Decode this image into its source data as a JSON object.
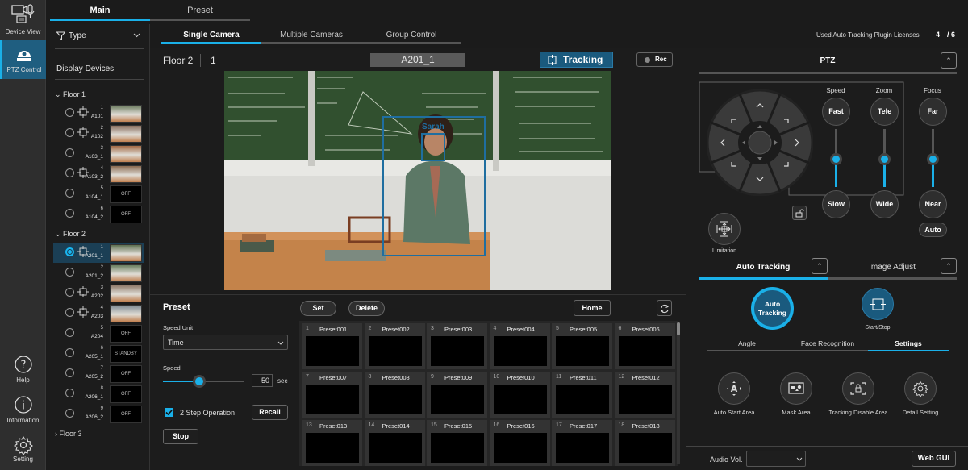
{
  "nav": {
    "items": [
      {
        "label": "Device View",
        "icon": "device-view-icon"
      },
      {
        "label": "PTZ Control",
        "icon": "ptz-camera-icon",
        "active": true
      },
      {
        "label": "Help",
        "icon": "help-icon"
      },
      {
        "label": "Information",
        "icon": "information-icon"
      },
      {
        "label": "Setting",
        "icon": "gear-icon"
      }
    ]
  },
  "top_tabs": [
    {
      "label": "Main",
      "selected": true
    },
    {
      "label": "Preset"
    }
  ],
  "device_panel": {
    "filter_label": "Type",
    "title": "Display Devices",
    "floors": [
      {
        "name": "Floor 1",
        "expanded": true,
        "devices": [
          {
            "num": "1",
            "name": "A101",
            "tracking": true,
            "state": "image"
          },
          {
            "num": "2",
            "name": "A102",
            "tracking": true,
            "state": "image"
          },
          {
            "num": "3",
            "name": "A103_1",
            "tracking": false,
            "state": "image"
          },
          {
            "num": "4",
            "name": "A103_2",
            "tracking": true,
            "state": "image"
          },
          {
            "num": "5",
            "name": "A104_1",
            "tracking": false,
            "state": "OFF"
          },
          {
            "num": "6",
            "name": "A104_2",
            "tracking": false,
            "state": "OFF"
          }
        ]
      },
      {
        "name": "Floor 2",
        "expanded": true,
        "devices": [
          {
            "num": "1",
            "name": "A201_1",
            "tracking": true,
            "state": "image",
            "selected": true
          },
          {
            "num": "2",
            "name": "A201_2",
            "tracking": false,
            "state": "image"
          },
          {
            "num": "3",
            "name": "A202",
            "tracking": true,
            "state": "image"
          },
          {
            "num": "4",
            "name": "A203",
            "tracking": true,
            "state": "image"
          },
          {
            "num": "5",
            "name": "A204",
            "tracking": false,
            "state": "OFF"
          },
          {
            "num": "6",
            "name": "A205_1",
            "tracking": false,
            "state": "STANDBY"
          },
          {
            "num": "7",
            "name": "A205_2",
            "tracking": false,
            "state": "OFF"
          },
          {
            "num": "8",
            "name": "A206_1",
            "tracking": false,
            "state": "OFF"
          },
          {
            "num": "9",
            "name": "A206_2",
            "tracking": false,
            "state": "OFF"
          }
        ]
      },
      {
        "name": "Floor 3",
        "expanded": false,
        "devices": []
      }
    ]
  },
  "sub_tabs": [
    {
      "label": "Single Camera",
      "selected": true
    },
    {
      "label": "Multiple Cameras"
    },
    {
      "label": "Group Control"
    }
  ],
  "license": {
    "label": "Used Auto Tracking Plugin Licenses",
    "used": "4",
    "total": "/ 6"
  },
  "viewer": {
    "floor": "Floor 2",
    "number": "1",
    "camera_name": "A201_1",
    "tracking_label": "Tracking",
    "rec_label": "Rec",
    "face_label": "Sarah"
  },
  "preset": {
    "title": "Preset",
    "speed_unit_label": "Speed Unit",
    "speed_unit_value": "Time",
    "speed_label": "Speed",
    "speed_value": "50",
    "speed_unit_suffix": "sec",
    "speed_fraction": 0.45,
    "two_step_label": "2 Step Operation",
    "two_step_checked": true,
    "recall_label": "Recall",
    "stop_label": "Stop",
    "set_label": "Set",
    "delete_label": "Delete",
    "home_label": "Home",
    "items": [
      {
        "num": "1",
        "name": "Preset001"
      },
      {
        "num": "2",
        "name": "Preset002"
      },
      {
        "num": "3",
        "name": "Preset003"
      },
      {
        "num": "4",
        "name": "Preset004"
      },
      {
        "num": "5",
        "name": "Preset005"
      },
      {
        "num": "6",
        "name": "Preset006"
      },
      {
        "num": "7",
        "name": "Preset007"
      },
      {
        "num": "8",
        "name": "Preset008"
      },
      {
        "num": "9",
        "name": "Preset009"
      },
      {
        "num": "10",
        "name": "Preset010"
      },
      {
        "num": "11",
        "name": "Preset011"
      },
      {
        "num": "12",
        "name": "Preset012"
      },
      {
        "num": "13",
        "name": "Preset013"
      },
      {
        "num": "14",
        "name": "Preset014"
      },
      {
        "num": "15",
        "name": "Preset015"
      },
      {
        "num": "16",
        "name": "Preset016"
      },
      {
        "num": "17",
        "name": "Preset017"
      },
      {
        "num": "18",
        "name": "Preset018"
      }
    ]
  },
  "ptz": {
    "title": "PTZ",
    "speed_label": "Speed",
    "speed_top": "Fast",
    "speed_bottom": "Slow",
    "zoom_label": "Zoom",
    "zoom_top": "Tele",
    "zoom_bottom": "Wide",
    "focus_label": "Focus",
    "focus_top": "Far",
    "focus_bottom": "Near",
    "focus_auto": "Auto",
    "limitation_label": "Limitation"
  },
  "tracking_tabs": [
    {
      "label": "Auto Tracking",
      "selected": true
    },
    {
      "label": "Image Adjust"
    }
  ],
  "auto_tracking": {
    "button_line1": "Auto",
    "button_line2": "Tracking",
    "start_stop_label": "Start/Stop",
    "sub_tabs": [
      {
        "label": "Angle"
      },
      {
        "label": "Face Recognition"
      },
      {
        "label": "Settings",
        "selected": true
      }
    ],
    "settings": [
      {
        "label": "Auto Start Area",
        "icon": "auto-start-area-icon"
      },
      {
        "label": "Mask Area",
        "icon": "mask-area-icon"
      },
      {
        "label": "Tracking Disable Area",
        "icon": "tracking-disable-area-icon"
      },
      {
        "label": "Detail Setting",
        "icon": "gear-icon"
      }
    ]
  },
  "footer": {
    "audio_label": "Audio Vol.",
    "audio_value": "",
    "web_gui_label": "Web GUI"
  },
  "colors": {
    "accent": "#1ab0e8",
    "active_nav": "#1f5e80",
    "tracking_btn": "#1a5a7e"
  }
}
